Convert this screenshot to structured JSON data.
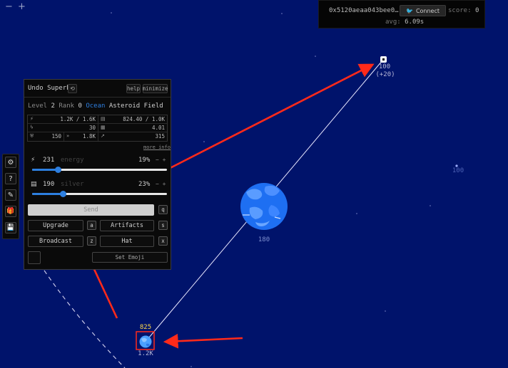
{
  "top_controls": {
    "zoom_out": "−",
    "zoom_in": "+"
  },
  "account": {
    "address": "0x5120aeaa043bee0…",
    "connect_label": "Connect",
    "score_label": "score:",
    "score_value": "0",
    "avg_label": "avg:",
    "avg_value": "6.09s"
  },
  "toolbar": {
    "items": [
      {
        "icon": "gear-icon",
        "glyph": "⚙"
      },
      {
        "icon": "help-icon",
        "glyph": "?"
      },
      {
        "icon": "plugin-icon",
        "glyph": "✎"
      },
      {
        "icon": "gift-icon",
        "glyph": "🎁"
      },
      {
        "icon": "save-icon",
        "glyph": "💾"
      }
    ]
  },
  "panel": {
    "planet_name": "Undo Superb",
    "help_label": "help",
    "minimize_label": "minimize",
    "level_label": "Level",
    "level_value": "2",
    "rank_label": "Rank",
    "rank_value": "0",
    "biome": "Ocean",
    "type": "Asteroid Field",
    "stats": {
      "energy": "1.2K / 1.6K",
      "silver": "824.40 / 1.0K",
      "energy_growth": "30",
      "silver_growth": "4.01",
      "defense": "150",
      "speed": "1.8K",
      "range": "315"
    },
    "more_info": "more info",
    "energy_slider": {
      "amount": "231",
      "label": "energy",
      "percent_text": "19%",
      "percent": 19
    },
    "silver_slider": {
      "amount": "190",
      "label": "silver",
      "percent_text": "23%",
      "percent": 23
    },
    "minus": "−",
    "plus": "+",
    "send_label": "Send",
    "send_key": "q",
    "upgrade_label": "Upgrade",
    "upgrade_key": "a",
    "artifacts_label": "Artifacts",
    "artifacts_key": "s",
    "broadcast_label": "Broadcast",
    "broadcast_key": "z",
    "hat_label": "Hat",
    "hat_key": "x",
    "emoji_label": "Set Emoji"
  },
  "map": {
    "target_planet": {
      "energy": "100",
      "bonus": "(+20)"
    },
    "distant_planet": {
      "energy": "100"
    },
    "ocean_planet": {
      "energy": "180"
    },
    "home_planet": {
      "energy": "825",
      "label": "1.2K"
    }
  },
  "colors": {
    "space": "#00136b",
    "accent": "#2d7fe0",
    "arrow": "#ff2a1a"
  }
}
